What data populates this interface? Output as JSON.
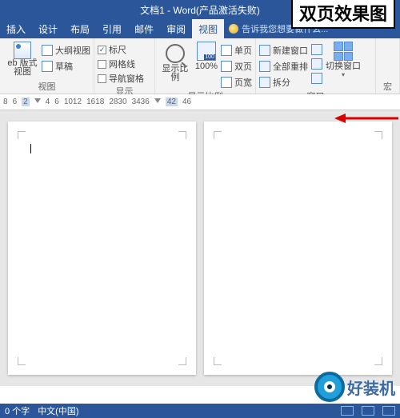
{
  "title": "文档1 - Word(产品激活失败)",
  "tabs": [
    "插入",
    "设计",
    "布局",
    "引用",
    "邮件",
    "审阅",
    "视图"
  ],
  "activeTab": "视图",
  "tellme": "告诉我您想要做什么...",
  "group_view": {
    "webLayout": "eb 版式视图",
    "outline": "大纲视图",
    "draft": "草稿",
    "label": "视图"
  },
  "group_show": {
    "ruler": "标尺",
    "gridlines": "网格线",
    "navpane": "导航窗格",
    "label": "显示"
  },
  "group_zoom": {
    "zoom": "显示比例",
    "hundred": "100%",
    "single": "单页",
    "multi": "双页",
    "width": "页宽",
    "label": "显示比例"
  },
  "group_window": {
    "neww": "新建窗口",
    "arrange": "全部重排",
    "split": "拆分",
    "switch": "切换窗口",
    "label": "窗口"
  },
  "group_macro": {
    "label": "宏"
  },
  "ruler_nums": [
    "8",
    "6",
    "2",
    "4",
    "6",
    "1012",
    "1618",
    "2830",
    "3436",
    "42",
    "46"
  ],
  "callout": "双页效果图",
  "status": {
    "words": "0 个字",
    "lang": "中文(中国)"
  },
  "watermark": "好装机"
}
